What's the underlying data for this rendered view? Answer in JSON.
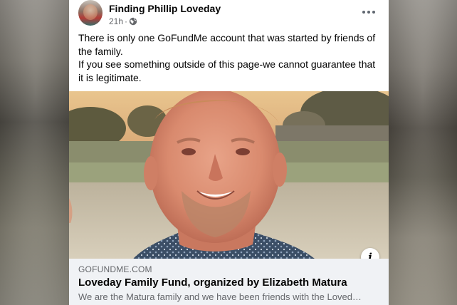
{
  "post": {
    "page_name": "Finding Phillip Loveday",
    "timestamp": "21h",
    "separator": "·",
    "privacy_icon": "globe-icon",
    "more_icon": "more-options-icon",
    "text_line_1": "There is only one GoFundMe account that was started by friends of the family.",
    "text_line_2": "If you see something outside of this page-we cannot guarantee that it is legitimate."
  },
  "link_preview": {
    "domain": "GOFUNDME.COM",
    "title": "Loveday Family Fund, organized by Elizabeth Matura",
    "description": "We are the Matura family and we have been friends with the Loved…",
    "info_icon": "info-icon",
    "info_label": "i"
  }
}
